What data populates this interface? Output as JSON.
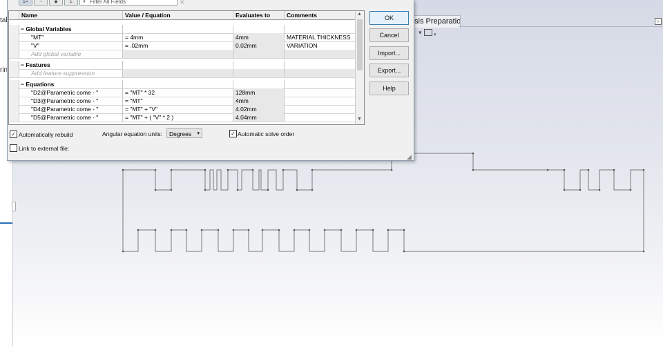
{
  "dialog": {
    "filter_placeholder": "Filter All Fields",
    "columns": [
      "Name",
      "Value / Equation",
      "Evaluates to",
      "Comments"
    ],
    "groups": {
      "global_variables": "Global Variables",
      "features": "Features",
      "equations": "Equations"
    },
    "global_variables": [
      {
        "name": "\"MT\"",
        "value": "= 4mm",
        "evaluates": "4mm",
        "comment": "MATERIAL THICKNESS"
      },
      {
        "name": "\"V\"",
        "value": "= .02mm",
        "evaluates": "0.02mm",
        "comment": "VARIATION"
      }
    ],
    "add_global_placeholder": "Add global variable",
    "add_feature_placeholder": "Add feature suppression",
    "equations": [
      {
        "name": "\"D2@Parametric come - \"",
        "value": "= \"MT\" * 32",
        "evaluates": "128mm",
        "comment": ""
      },
      {
        "name": "\"D3@Parametric come - \"",
        "value": "= \"MT\"",
        "evaluates": "4mm",
        "comment": ""
      },
      {
        "name": "\"D4@Parametric come - \"",
        "value": "= \"MT\" + \"V\"",
        "evaluates": "4.02mm",
        "comment": ""
      },
      {
        "name": "\"D5@Parametric come - \"",
        "value": "= \"MT\" + ( \"V\" * 2 )",
        "evaluates": "4.04mm",
        "comment": ""
      }
    ],
    "buttons": {
      "ok": "OK",
      "cancel": "Cancel",
      "import": "Import...",
      "export": "Export...",
      "help": "Help"
    },
    "auto_rebuild_label": "Automatically rebuild",
    "auto_rebuild_checked": "✓",
    "angular_units_label": "Angular equation units:",
    "angular_units_value": "Degrees",
    "auto_solve_label": "Automatic solve order",
    "auto_solve_checked": "✓",
    "link_external_label": "Link to external file:"
  },
  "left_tabs": [
    "tal",
    "rin"
  ],
  "doc_tab": "sis Preparation",
  "icons": {
    "collapse": "collapse-icon",
    "display": "display-icon",
    "filter": "filter-icon",
    "wrench": "wrench-icon"
  }
}
